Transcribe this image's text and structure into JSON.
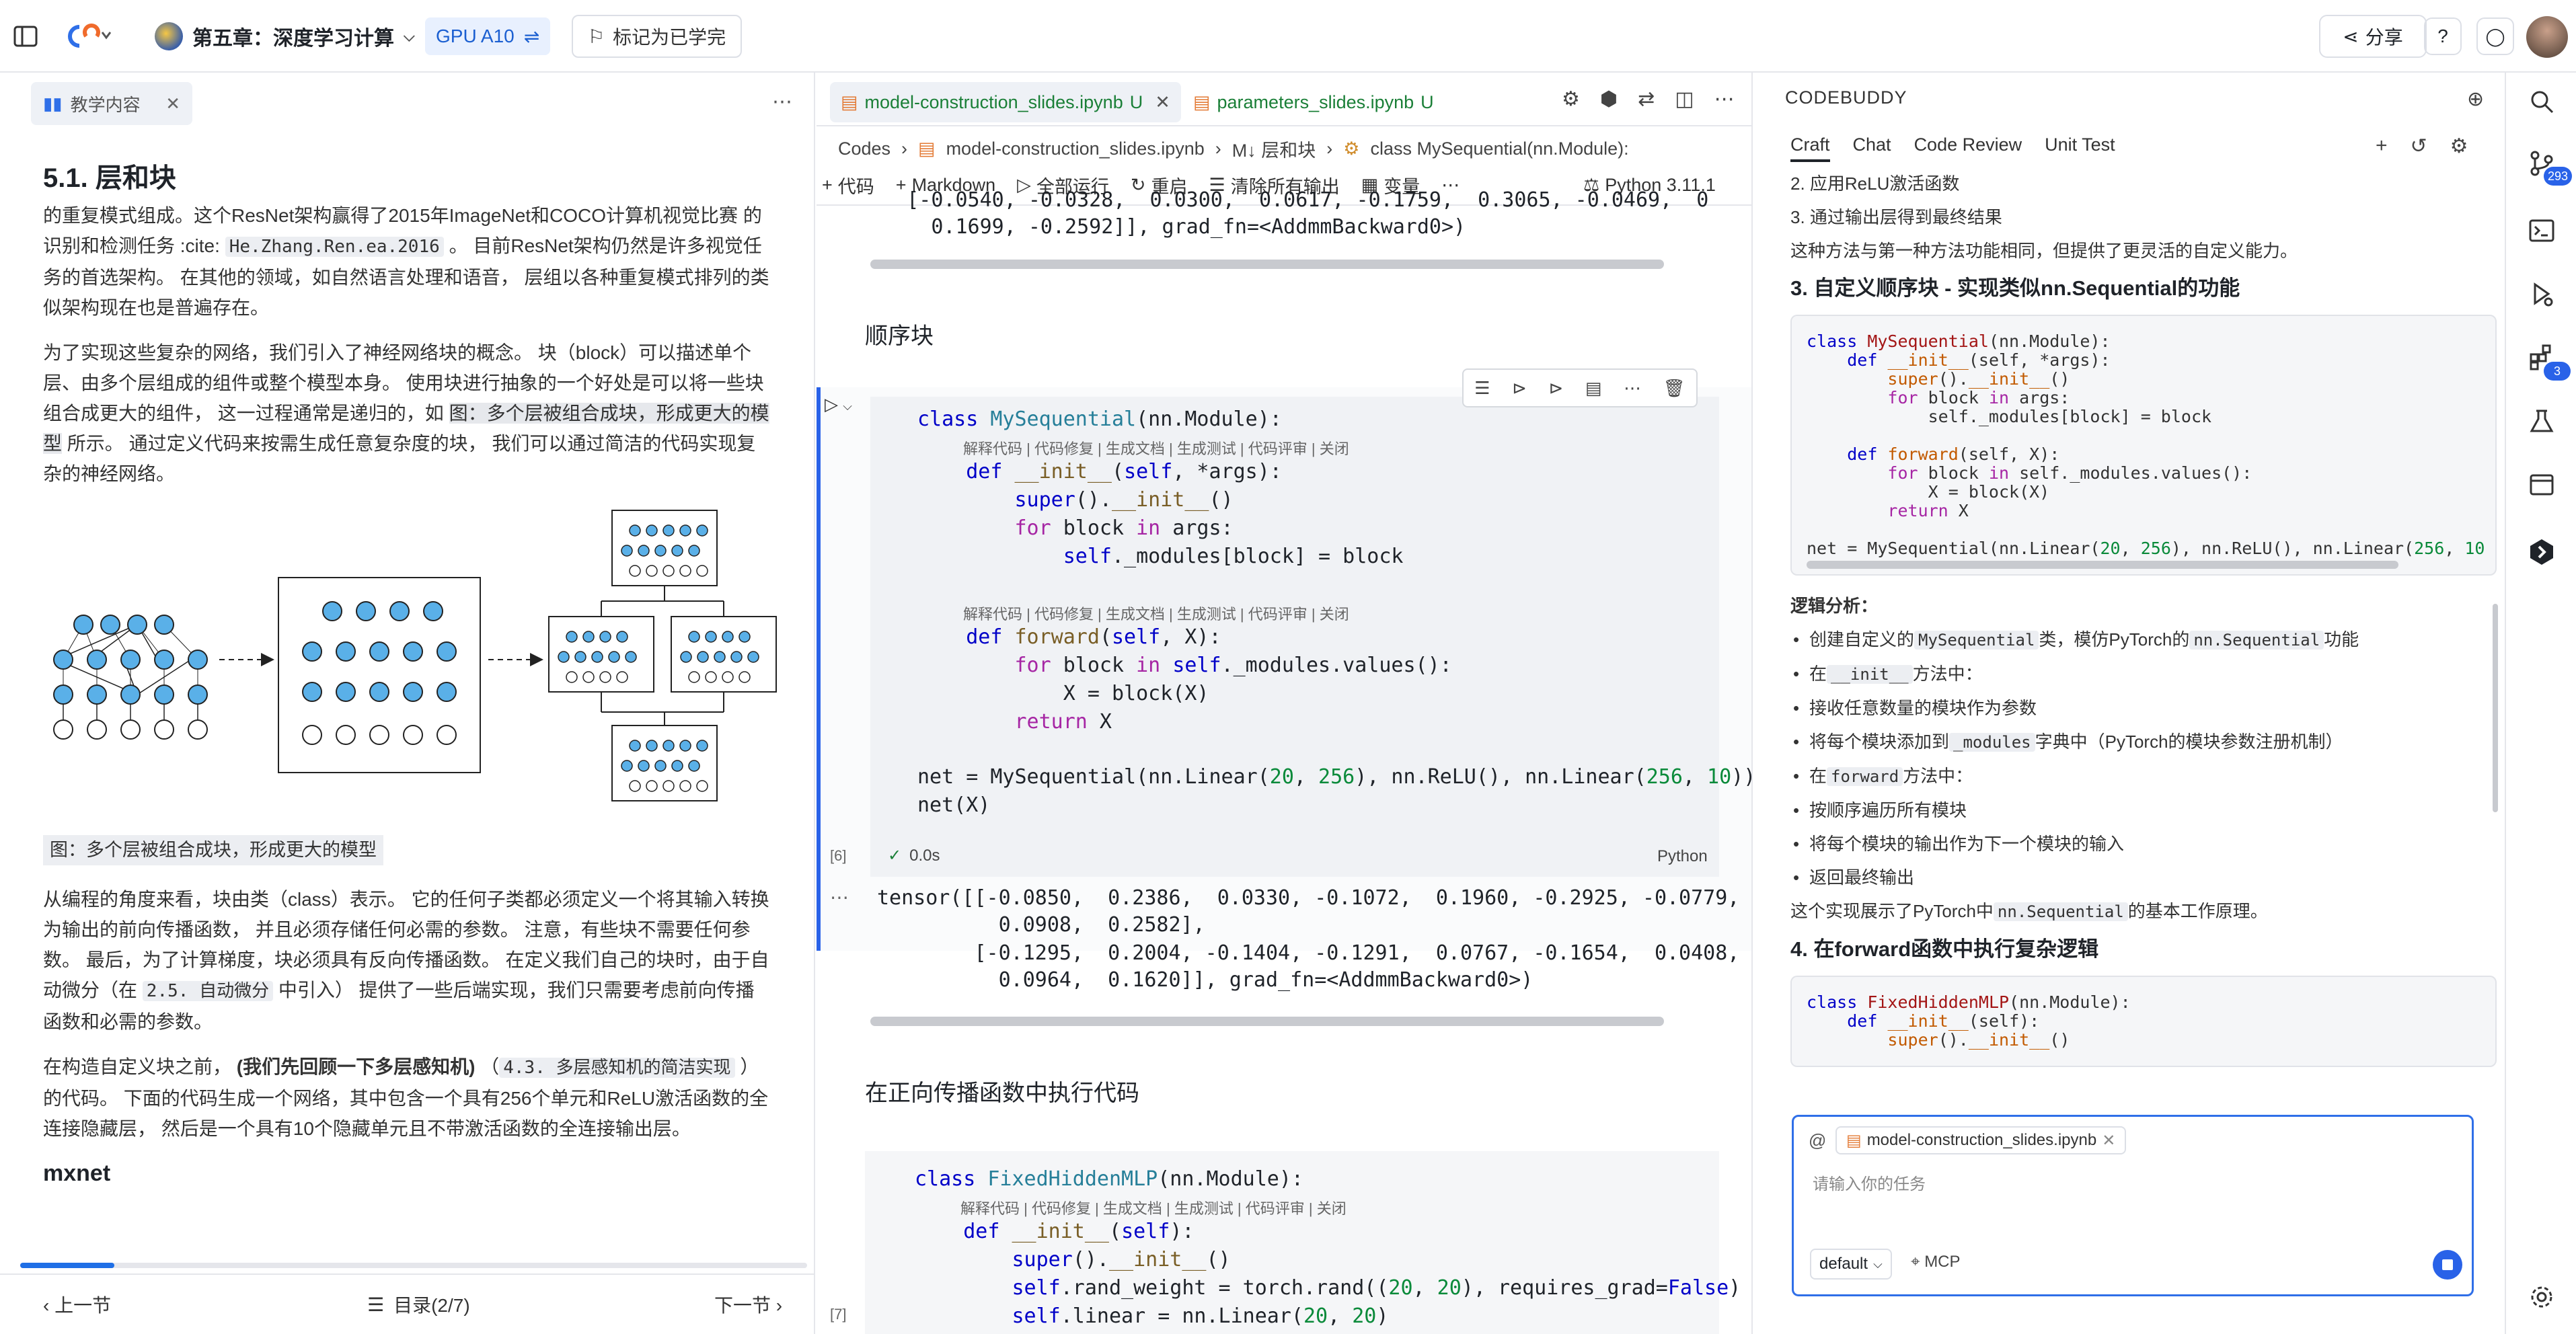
{
  "topbar": {
    "course_title": "第五章：深度学习计算",
    "gpu_label": "GPU A10",
    "mark_learned": "标记为已学完",
    "share": "分享"
  },
  "left": {
    "tab_label": "教学内容",
    "title": "5.1. 层和块",
    "para1_a": "的重复模式组成。这个ResNet架构赢得了2015年ImageNet和COCO计算机视觉比赛 的识别和检测任务 :cite:",
    "para1_cite": "He.Zhang.Ren.ea.2016",
    "para1_b": "。 目前ResNet架构仍然是许多视觉任务的首选架构。 在其他的领域，如自然语言处理和语音， 层组以各种重复模式排列的类似架构现在也是普遍存在。",
    "para2_a": "为了实现这些复杂的网络，我们引入了神经网络块的概念。 块（block）可以描述单个层、由多个层组成的组件或整个模型本身。 使用块进行抽象的一个好处是可以将一些块组合成更大的组件， 这一过程通常是递归的，如",
    "para2_link": "图：多个层被组合成块，形成更大的模型",
    "para2_b": "所示。 通过定义代码来按需生成任意复杂度的块， 我们可以通过简洁的代码实现复杂的神经网络。",
    "fig_caption": "图：多个层被组合成块，形成更大的模型",
    "para3_a": "从编程的角度来看，块由类（class）表示。 它的任何子类都必须定义一个将其输入转换为输出的前向传播函数， 并且必须存储任何必需的参数。 注意，有些块不需要任何参数。 最后，为了计算梯度，块必须具有反向传播函数。 在定义我们自己的块时，由于自动微分（在",
    "para3_ref": "2.5. 自动微分",
    "para3_b": "中引入） 提供了一些后端实现，我们只需要考虑前向传播函数和必需的参数。",
    "para4_a": "在构造自定义块之前，",
    "para4_bold": "(我们先回顾一下多层感知机)",
    "para4_ref": "4.3. 多层感知机的简洁实现",
    "para4_b": "）的代码。 下面的代码生成一个网络，其中包含一个具有256个单元和ReLU激活函数的全连接隐藏层， 然后是一个具有10个隐藏单元且不带激活函数的全连接输出层。",
    "mxnet_heading": "mxnet",
    "progress": 0.12,
    "prev": "上一节",
    "toc": "目录(2/7)",
    "next": "下一节"
  },
  "middle": {
    "tabs": [
      {
        "label": "model-construction_slides.ipynb",
        "status": "U"
      },
      {
        "label": "parameters_slides.ipynb",
        "status": "U"
      }
    ],
    "breadcrumb": [
      "Codes",
      "model-construction_slides.ipynb",
      "M↓ 层和块",
      "class MySequential(nn.Module):"
    ],
    "toolbar": {
      "code": "代码",
      "markdown": "Markdown",
      "run_all": "全部运行",
      "restart": "重启",
      "clear_outputs": "清除所有输出",
      "variables": "变量",
      "kernel": "Python 3.11.1"
    },
    "prev_output": [
      "    [-0.0540, -0.0328,  0.0300,  0.0617, -0.1759,  0.3065, -0.0469,  0",
      "      0.1699, -0.2592]], grad_fn=<AddmmBackward0>)"
    ],
    "heading_seq": "顺序块",
    "cell6": {
      "exec_count": "[6]",
      "time": "0.0s",
      "lang": "Python",
      "ops": "解释代码 | 代码修复 | 生成文档 | 生成测试 | 代码评审 | 关闭"
    },
    "output6": [
      "tensor([[-0.0850,  0.2386,  0.0330, -0.1072,  0.1960, -0.2925, -0.0779,  0",
      "          0.0908,  0.2582],",
      "        [-0.1295,  0.2004, -0.1404, -0.1291,  0.0767, -0.1654,  0.0408,  0",
      "          0.0964,  0.1620]], grad_fn=<AddmmBackward0>)"
    ],
    "heading_forward": "在正向传播函数中执行代码",
    "cell7": {
      "exec_count": "[7]",
      "ops": "解释代码 | 代码修复 | 生成文档 | 生成测试 | 代码评审 | 关闭"
    }
  },
  "right": {
    "title": "CODEBUDDY",
    "tabs": [
      "Craft",
      "Chat",
      "Code Review",
      "Unit Test"
    ],
    "line_top1": "2. 应用ReLU激活函数",
    "line_top2": "3. 通过输出层得到最终结果",
    "line_top3": "这种方法与第一种方法功能相同，但提供了更灵活的自定义能力。",
    "heading3": "3. 自定义顺序块 - 实现类似nn.Sequential的功能",
    "logic_label": "逻辑分析：",
    "bullets": [
      {
        "a": "创建自定义的",
        "k1": "MySequential",
        "b": "类，模仿PyTorch的",
        "k2": "nn.Sequential",
        "c": "功能"
      },
      {
        "a": "在",
        "k1": "__init__",
        "b": "方法中：",
        "k2": "",
        "c": ""
      },
      {
        "a": "接收任意数量的模块作为参数",
        "k1": "",
        "b": "",
        "k2": "",
        "c": ""
      },
      {
        "a": "将每个模块添加到",
        "k1": "_modules",
        "b": "字典中（PyTorch的模块参数注册机制）",
        "k2": "",
        "c": ""
      },
      {
        "a": "在",
        "k1": "forward",
        "b": "方法中：",
        "k2": "",
        "c": ""
      },
      {
        "a": "按顺序遍历所有模块",
        "k1": "",
        "b": "",
        "k2": "",
        "c": ""
      },
      {
        "a": "将每个模块的输出作为下一个模块的输入",
        "k1": "",
        "b": "",
        "k2": "",
        "c": ""
      },
      {
        "a": "返回最终输出",
        "k1": "",
        "b": "",
        "k2": "",
        "c": ""
      }
    ],
    "summary_a": "这个实现展示了PyTorch中",
    "summary_k": "nn.Sequential",
    "summary_b": "的基本工作原理。",
    "heading4": "4. 在forward函数中执行复杂逻辑",
    "input_chip": "model-construction_slides.ipynb",
    "input_placeholder": "请输入你的任务",
    "model": "default",
    "mcp": "MCP"
  },
  "activity": {
    "badge_git": "293",
    "badge_ext": "3"
  }
}
